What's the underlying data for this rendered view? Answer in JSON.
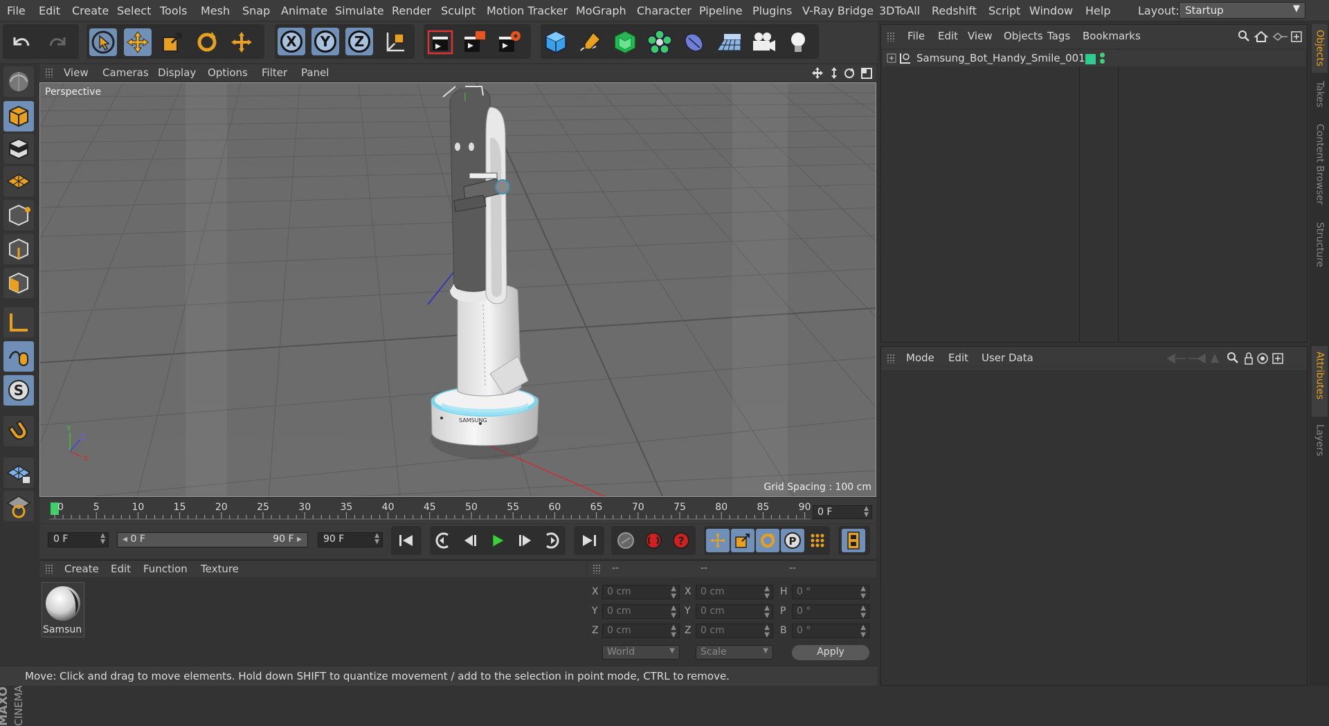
{
  "menubar": {
    "items": [
      "File",
      "Edit",
      "Create",
      "Select",
      "Tools",
      "Mesh",
      "Snap",
      "Animate",
      "Simulate",
      "Render",
      "Sculpt",
      "Motion Tracker",
      "MoGraph",
      "Character",
      "Pipeline",
      "Plugins",
      "V-Ray Bridge",
      "3DToAll",
      "Redshift",
      "Script",
      "Window",
      "Help"
    ],
    "layout_label": "Layout:",
    "layout_value": "Startup"
  },
  "toolbar": {
    "undo": "undo-icon",
    "redo": "redo-icon",
    "tools": [
      "select-arrow-icon",
      "move-icon",
      "scale-icon",
      "rotate-icon",
      "recent-tool-icon"
    ],
    "axes": [
      "X",
      "Y",
      "Z"
    ],
    "coord_system": "world-coordinates-icon",
    "render": [
      "render-view-icon",
      "render-picture-viewer-icon",
      "render-settings-icon"
    ],
    "create": [
      "cube-icon",
      "pen-spline-icon",
      "subdivision-icon",
      "cloner-icon",
      "deformer-icon",
      "floor-icon",
      "camera-icon",
      "light-icon"
    ]
  },
  "viewport": {
    "menu": [
      "View",
      "Cameras",
      "Display",
      "Options",
      "Filter",
      "Panel"
    ],
    "label": "Perspective",
    "grid_spacing": "Grid Spacing : 100 cm",
    "model_badge": "SAMSUNG"
  },
  "timeline": {
    "ticks": [
      "0",
      "5",
      "10",
      "15",
      "20",
      "25",
      "30",
      "35",
      "40",
      "45",
      "50",
      "55",
      "60",
      "65",
      "70",
      "75",
      "80",
      "85",
      "90"
    ],
    "current_frame": "0 F"
  },
  "transport": {
    "start_frame": "0 F",
    "range_start": "0 F",
    "range_end": "90 F",
    "end_frame": "90 F"
  },
  "material_manager": {
    "menu": [
      "Create",
      "Edit",
      "Function",
      "Texture"
    ],
    "materials": [
      {
        "name": "Samsun"
      }
    ]
  },
  "coordinates": {
    "headers": [
      "--",
      "--",
      "--"
    ],
    "rows": [
      {
        "l1": "X",
        "v1": "0 cm",
        "l2": "X",
        "v2": "0 cm",
        "l3": "H",
        "v3": "0 °"
      },
      {
        "l1": "Y",
        "v1": "0 cm",
        "l2": "Y",
        "v2": "0 cm",
        "l3": "P",
        "v3": "0 °"
      },
      {
        "l1": "Z",
        "v1": "0 cm",
        "l2": "Z",
        "v2": "0 cm",
        "l3": "B",
        "v3": "0 °"
      }
    ],
    "space": "World",
    "mode": "Scale",
    "apply": "Apply"
  },
  "status": "Move: Click and drag to move elements. Hold down SHIFT to quantize movement / add to the selection in point mode, CTRL to remove.",
  "object_manager": {
    "menu": [
      "File",
      "Edit",
      "View",
      "Objects",
      "Tags",
      "Bookmarks"
    ],
    "objects": [
      {
        "name": "Samsung_Bot_Handy_Smile_001",
        "layer_color": "#2ecc8f"
      }
    ]
  },
  "attribute_manager": {
    "menu": [
      "Mode",
      "Edit",
      "User Data"
    ]
  },
  "right_tabs": [
    "Objects",
    "Takes",
    "Content Browser",
    "Structure",
    "Attributes",
    "Layers"
  ],
  "brand": {
    "maxon": "MAXON",
    "product": "CINEMA 4D"
  },
  "colors": {
    "accent_orange": "#e8a020",
    "selected_blue": "#7090b8",
    "play_green": "#3ecf3e"
  }
}
